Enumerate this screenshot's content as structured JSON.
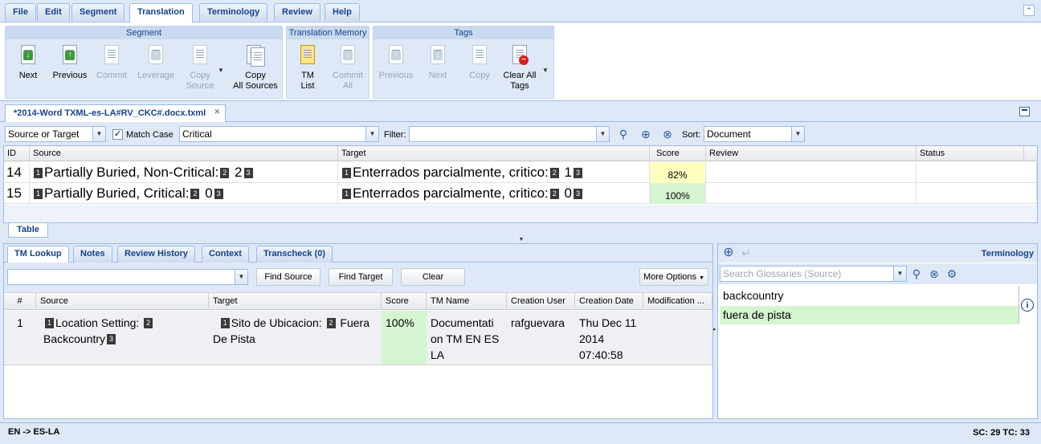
{
  "menu": {
    "tabs": [
      "File",
      "Edit",
      "Segment",
      "Translation",
      "Terminology",
      "Review",
      "Help"
    ],
    "active": "Translation"
  },
  "ribbon": {
    "segment_group": "Segment",
    "tm_group": "Translation Memory",
    "tags_group": "Tags",
    "next": "Next",
    "previous": "Previous",
    "commit": "Commit",
    "leverage": "Leverage",
    "copy_source_1": "Copy",
    "copy_source_2": "Source",
    "copy_all_1": "Copy",
    "copy_all_2": "All Sources",
    "tm_list_1": "TM",
    "tm_list_2": "List",
    "commit_all_1": "Commit",
    "commit_all_2": "All",
    "tags_previous": "Previous",
    "tags_next": "Next",
    "tags_copy": "Copy",
    "clear_tags_1": "Clear All",
    "clear_tags_2": "Tags"
  },
  "file_tab": "*2014-Word TXML-es-LA#RV_CKC#.docx.txml",
  "filter": {
    "scope": "Source or Target",
    "match_case": "Match Case",
    "search_value": "Critical",
    "filter_label": "Filter:",
    "filter_value": "",
    "sort_label": "Sort:",
    "sort_value": "Document"
  },
  "grid": {
    "headers": [
      "ID",
      "Source",
      "Target",
      "Score",
      "Review",
      "Status"
    ],
    "rows": [
      {
        "id": "14",
        "src_pre": "Partially Buried, Non-Critical:",
        "src_tag1": "1",
        "src_t2": "2",
        "src_num": "2",
        "src_t3": "3",
        "tgt_pre": "Enterrados parcialmente, critico:",
        "tgt_tag1": "1",
        "tgt_t2": "2",
        "tgt_num": "1",
        "tgt_t3": "3",
        "score": "82%",
        "score_color": "#ffffc0"
      },
      {
        "id": "15",
        "src_pre": "Partially Buried, Critical:",
        "src_tag1": "1",
        "src_t2": "2",
        "src_num": "0",
        "src_t3": "3",
        "tgt_pre": "Enterrados parcialmente, critico:",
        "tgt_tag1": "1",
        "tgt_t2": "2",
        "tgt_num": "0",
        "tgt_t3": "3",
        "score": "100%",
        "score_color": "#d5f5d0"
      }
    ]
  },
  "table_tab": "Table",
  "lower": {
    "tabs": [
      "TM Lookup",
      "Notes",
      "Review History",
      "Context",
      "Transcheck (0)"
    ],
    "find_source": "Find Source",
    "find_target": "Find Target",
    "clear": "Clear",
    "more_options": "More Options",
    "headers": [
      "#",
      "Source",
      "Target",
      "Score",
      "TM Name",
      "Creation User",
      "Creation Date",
      "Modification ..."
    ],
    "row": {
      "num": "1",
      "src_a": "Location Setting:",
      "src_b": "Backcountry",
      "tgt_a": "Sito de Ubicacion:",
      "tgt_b": "Fuera",
      "tgt_c": "De Pista",
      "score": "100%",
      "tm_name": "Documentati on TM EN ESLA",
      "user": "rafguevara",
      "date": "Thu Dec 11 2014 07:40:58",
      "tag1": "1",
      "tag2": "2",
      "tag3": "3"
    }
  },
  "terminology": {
    "title": "Terminology",
    "search_placeholder": "Search Glossaries (Source)",
    "source_term": "backcountry",
    "target_term": "fuera de pista"
  },
  "status": {
    "lang": "EN -> ES-LA",
    "counts": "SC: 29 TC: 33"
  }
}
